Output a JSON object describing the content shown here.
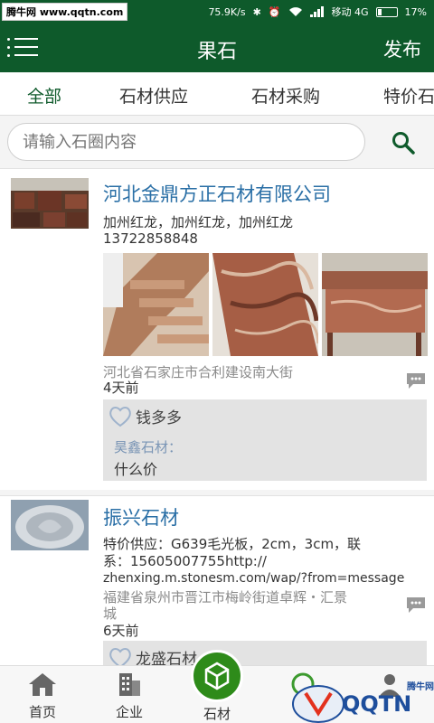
{
  "status_bar": {
    "watermark": "腾牛网 www.qqtn.com",
    "speed": "75.9K/s",
    "carrier": "移动 4G",
    "battery": "17%",
    "battery_level": 0.17
  },
  "app_bar": {
    "title": "果石",
    "publish_label": "发布"
  },
  "tabs": [
    {
      "label": "全部",
      "active": true
    },
    {
      "label": "石材供应",
      "active": false
    },
    {
      "label": "石材采购",
      "active": false
    },
    {
      "label": "特价石",
      "active": false
    }
  ],
  "search": {
    "placeholder": "请输入石圈内容"
  },
  "posts": [
    {
      "title": "河北金鼎方正石材有限公司",
      "subtitle": "加州红龙，加州红龙，加州红龙",
      "phone": "13722858848",
      "location": "河北省石家庄市合利建设南大街",
      "time": "4天前",
      "likes": "钱多多",
      "reply_author": "昊鑫石材：",
      "reply_text": "什么价"
    },
    {
      "title": "振兴石材",
      "body_line1": "特价供应：G639毛光板，2cm，3cm，联",
      "body_line2": "系：15605007755http://",
      "body_line3": "zhenxing.m.stonesm.com/wap/?from=message",
      "location_line1": "福建省泉州市晋江市梅岭街道卓辉・汇景",
      "location_line2": "城",
      "time": "6天前",
      "likes": "龙盛石材"
    }
  ],
  "bottom_nav": {
    "home": "首页",
    "company": "企业",
    "stone": "石材"
  },
  "watermark_bottom": {
    "text": "QQTN",
    "sub": "腾牛网"
  }
}
